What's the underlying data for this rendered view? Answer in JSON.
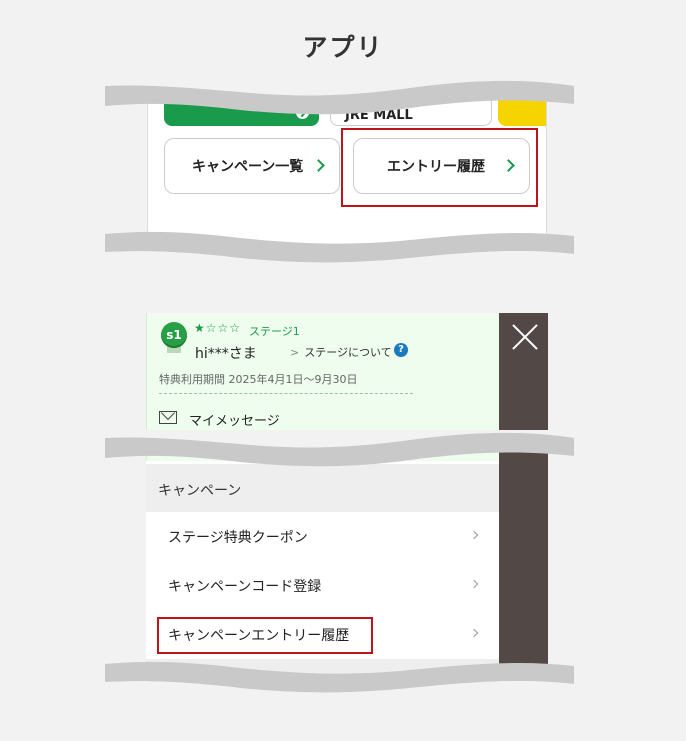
{
  "heading": "アプリ",
  "app_screen": {
    "partial_top_button": "JRE MALL",
    "campaign_list_button": "キャンペーン一覧",
    "entry_history_button": "エントリー履歴"
  },
  "menu_screen": {
    "badge": "s1",
    "stars": "★☆☆☆",
    "stage": "ステージ1",
    "username": "hi***さま",
    "stage_link": "ステージについて",
    "help_mark": "?",
    "benefit_period": "特典利用期間 2025年4月1日～9月30日",
    "my_message": "マイメッセージ",
    "section_title": "キャンペーン",
    "items": [
      {
        "label": "ステージ特典クーポン"
      },
      {
        "label": "キャンペーンコード登録"
      },
      {
        "label": "キャンペーンエントリー履歴"
      }
    ]
  },
  "colors": {
    "accent_green": "#1a9a4b",
    "highlight_red": "#c0141b",
    "drawer_dark": "#524946",
    "jre_yellow": "#f5d400"
  }
}
